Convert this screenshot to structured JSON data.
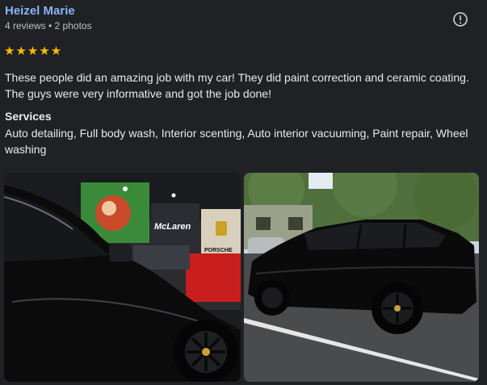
{
  "review": {
    "reviewer_name": "Heizel Marie",
    "reviewer_meta": "4 reviews • 2 photos",
    "rating": 5,
    "stars_text": "★★★★★",
    "text": "These people did an amazing job with my car! They did paint correction and ceramic coating. The guys were very informative and got the job done!",
    "services_heading": "Services",
    "services_list": "Auto detailing, Full body wash, Interior scenting, Auto interior vacuuming, Paint repair, Wheel washing",
    "report_icon": "alert-circle-icon"
  },
  "colors": {
    "background": "#202124",
    "name": "#8ab4f8",
    "stars": "#fbbc04",
    "text": "#e8eaed",
    "meta": "#bdc1c6"
  },
  "photos": [
    {
      "logo": "McLaren",
      "brand": "PORSCHE"
    },
    {}
  ]
}
